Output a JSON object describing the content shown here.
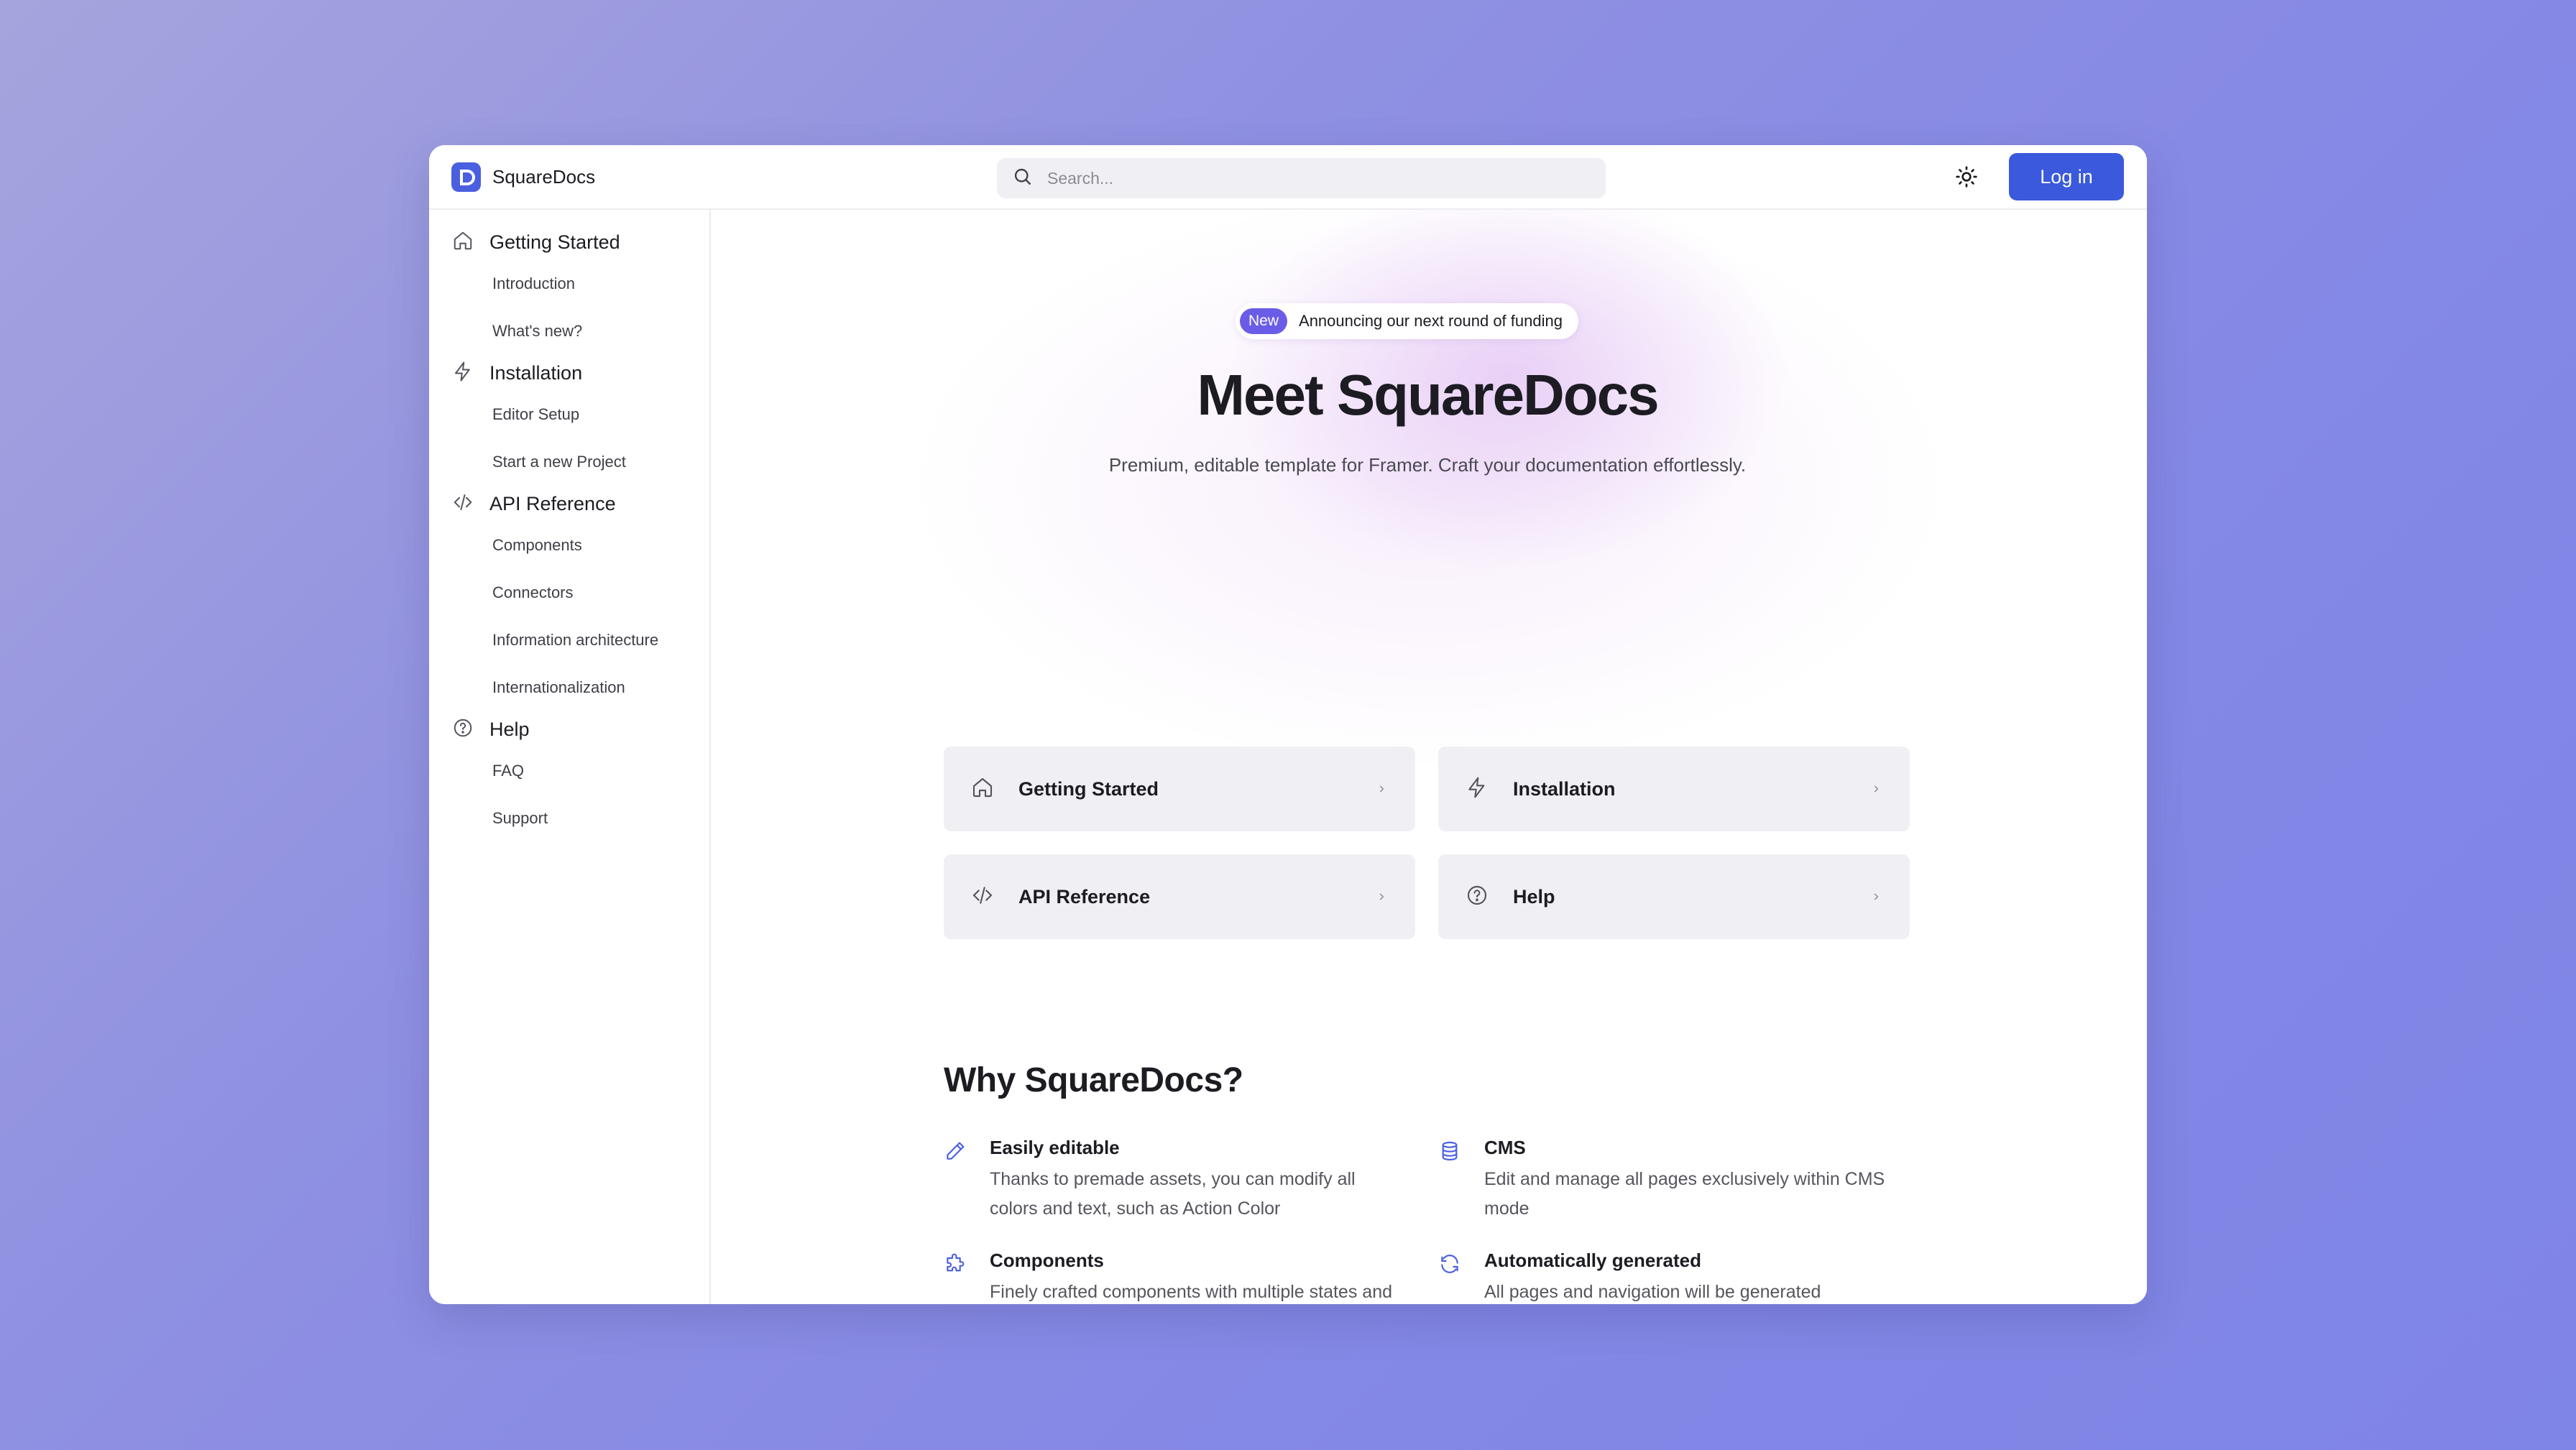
{
  "app": {
    "name": "SquareDocs"
  },
  "header": {
    "search_placeholder": "Search...",
    "login_label": "Log in"
  },
  "sidebar": {
    "sections": [
      {
        "label": "Getting Started",
        "icon": "home-icon",
        "items": [
          "Introduction",
          "What's new?"
        ]
      },
      {
        "label": "Installation",
        "icon": "lightning-icon",
        "items": [
          "Editor Setup",
          "Start a new Project"
        ]
      },
      {
        "label": "API Reference",
        "icon": "code-icon",
        "items": [
          "Components",
          "Connectors",
          "Information architecture",
          "Internationalization"
        ]
      },
      {
        "label": "Help",
        "icon": "help-circle-icon",
        "items": [
          "FAQ",
          "Support"
        ]
      }
    ]
  },
  "hero": {
    "badge_pill": "New",
    "badge_text": "Announcing our next round of funding",
    "title": "Meet SquareDocs",
    "subtitle": "Premium, editable template for Framer. Craft your documentation effortlessly."
  },
  "cards": [
    {
      "label": "Getting Started",
      "icon": "home-icon"
    },
    {
      "label": "Installation",
      "icon": "lightning-icon"
    },
    {
      "label": "API Reference",
      "icon": "code-icon"
    },
    {
      "label": "Help",
      "icon": "help-circle-icon"
    }
  ],
  "why": {
    "title": "Why SquareDocs?",
    "features": [
      {
        "title": "Easily editable",
        "desc": "Thanks to premade assets, you can modify all colors and text, such as Action Color",
        "icon": "pencil-icon"
      },
      {
        "title": "CMS",
        "desc": "Edit and manage all pages exclusively within CMS mode",
        "icon": "database-icon"
      },
      {
        "title": "Components",
        "desc": "Finely crafted components with multiple states and Variables",
        "icon": "puzzle-icon"
      },
      {
        "title": "Automatically generated",
        "desc": "All pages and navigation will be generated automatically from the CMS",
        "icon": "refresh-icon"
      }
    ]
  },
  "colors": {
    "accent": "#3a59dc",
    "badge": "#6b5ce7",
    "feature_icon": "#4a5fe0"
  }
}
